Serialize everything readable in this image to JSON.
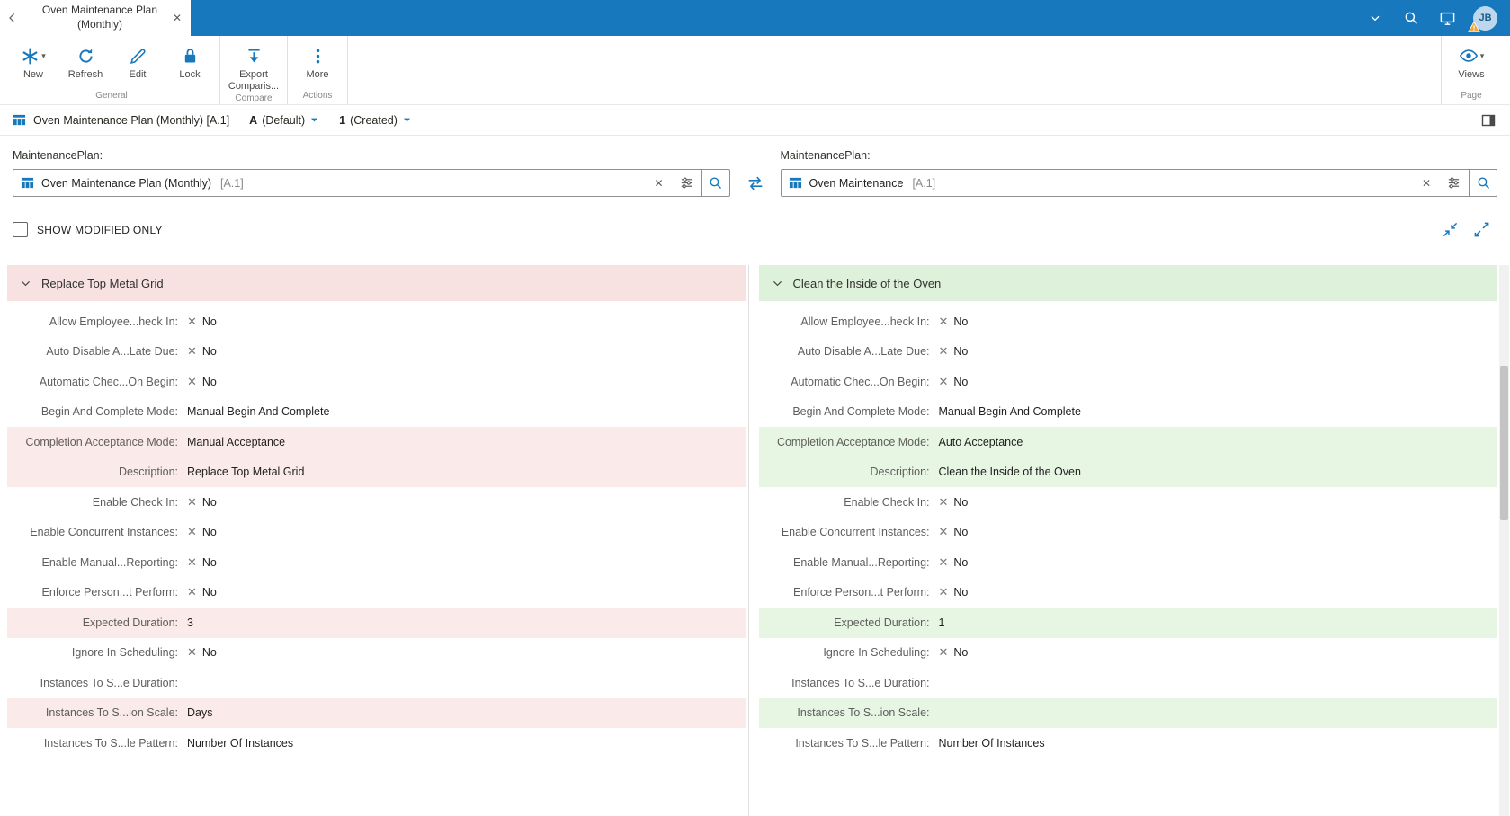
{
  "colors": {
    "accent_blue": "#1778bd",
    "removed_row_bg": "#fbeaea",
    "removed_header_bg": "#f7e1e1",
    "added_row_bg": "#e7f6e3",
    "added_header_bg": "#def1da",
    "scrollbar_track": "#f1f1f1",
    "scrollbar_thumb": "#c4c4c4"
  },
  "icons": {
    "close": "✕",
    "caret_down": "▾",
    "x_mark": "✕"
  },
  "topbar": {
    "tab_title": "Oven Maintenance Plan (Monthly)",
    "avatar_initials": "JB"
  },
  "ribbon": {
    "new_label": "New",
    "refresh_label": "Refresh",
    "edit_label": "Edit",
    "lock_label": "Lock",
    "export_label": "Export Comparis...",
    "more_label": "More",
    "views_label": "Views",
    "group_general": "General",
    "group_compare": "Compare",
    "group_actions": "Actions",
    "group_page": "Page"
  },
  "breadcrumb": {
    "title": "Oven Maintenance Plan (Monthly) [A.1]",
    "revision": "A",
    "revision_note": "(Default)",
    "state": "1",
    "state_note": "(Created)"
  },
  "compare": {
    "left_label": "MaintenancePlan:",
    "right_label": "MaintenancePlan:",
    "left_value": "Oven Maintenance Plan (Monthly)",
    "left_ref": "[A.1]",
    "right_value": "Oven Maintenance",
    "right_ref": "[A.1]",
    "show_modified_label": "SHOW MODIFIED ONLY"
  },
  "panels": {
    "left": {
      "header": "Replace Top Metal Grid",
      "diff": "removed",
      "rows": [
        {
          "label": "Allow Employee...heck In:",
          "value": "No",
          "x": true,
          "hl": false
        },
        {
          "label": "Auto Disable A...Late Due:",
          "value": "No",
          "x": true,
          "hl": false
        },
        {
          "label": "Automatic Chec...On Begin:",
          "value": "No",
          "x": true,
          "hl": false
        },
        {
          "label": "Begin And Complete Mode:",
          "value": "Manual Begin And Complete",
          "x": false,
          "hl": false
        },
        {
          "label": "Completion Acceptance Mode:",
          "value": "Manual Acceptance",
          "x": false,
          "hl": true
        },
        {
          "label": "Description:",
          "value": "Replace Top Metal Grid",
          "x": false,
          "hl": true
        },
        {
          "label": "Enable Check In:",
          "value": "No",
          "x": true,
          "hl": false
        },
        {
          "label": "Enable Concurrent Instances:",
          "value": "No",
          "x": true,
          "hl": false
        },
        {
          "label": "Enable Manual...Reporting:",
          "value": "No",
          "x": true,
          "hl": false
        },
        {
          "label": "Enforce Person...t Perform:",
          "value": "No",
          "x": true,
          "hl": false
        },
        {
          "label": "Expected Duration:",
          "value": "3",
          "x": false,
          "hl": true
        },
        {
          "label": "Ignore In Scheduling:",
          "value": "No",
          "x": true,
          "hl": false
        },
        {
          "label": "Instances To S...e Duration:",
          "value": "",
          "x": false,
          "hl": false
        },
        {
          "label": "Instances To S...ion Scale:",
          "value": "Days",
          "x": false,
          "hl": true
        },
        {
          "label": "Instances To S...le Pattern:",
          "value": "Number Of Instances",
          "x": false,
          "hl": false
        }
      ]
    },
    "right": {
      "header": "Clean the Inside of the Oven",
      "diff": "added",
      "rows": [
        {
          "label": "Allow Employee...heck In:",
          "value": "No",
          "x": true,
          "hl": false
        },
        {
          "label": "Auto Disable A...Late Due:",
          "value": "No",
          "x": true,
          "hl": false
        },
        {
          "label": "Automatic Chec...On Begin:",
          "value": "No",
          "x": true,
          "hl": false
        },
        {
          "label": "Begin And Complete Mode:",
          "value": "Manual Begin And Complete",
          "x": false,
          "hl": false
        },
        {
          "label": "Completion Acceptance Mode:",
          "value": "Auto Acceptance",
          "x": false,
          "hl": true
        },
        {
          "label": "Description:",
          "value": "Clean the Inside of the Oven",
          "x": false,
          "hl": true
        },
        {
          "label": "Enable Check In:",
          "value": "No",
          "x": true,
          "hl": false
        },
        {
          "label": "Enable Concurrent Instances:",
          "value": "No",
          "x": true,
          "hl": false
        },
        {
          "label": "Enable Manual...Reporting:",
          "value": "No",
          "x": true,
          "hl": false
        },
        {
          "label": "Enforce Person...t Perform:",
          "value": "No",
          "x": true,
          "hl": false
        },
        {
          "label": "Expected Duration:",
          "value": "1",
          "x": false,
          "hl": true
        },
        {
          "label": "Ignore In Scheduling:",
          "value": "No",
          "x": true,
          "hl": false
        },
        {
          "label": "Instances To S...e Duration:",
          "value": "",
          "x": false,
          "hl": false
        },
        {
          "label": "Instances To S...ion Scale:",
          "value": "",
          "x": false,
          "hl": true
        },
        {
          "label": "Instances To S...le Pattern:",
          "value": "Number Of Instances",
          "x": false,
          "hl": false
        }
      ]
    }
  }
}
